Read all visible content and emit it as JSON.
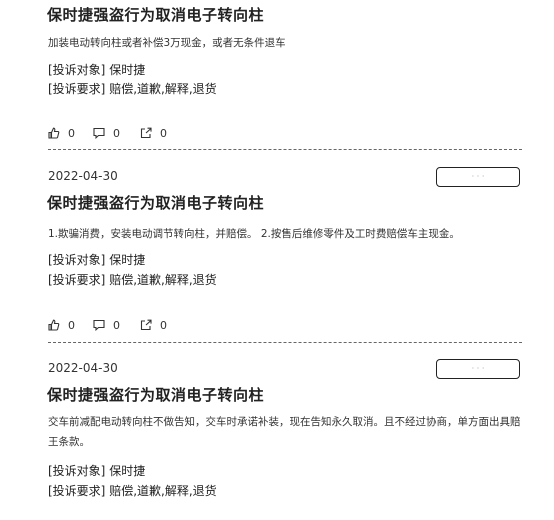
{
  "complaints": [
    {
      "title": "保时捷强盗行为取消电子转向柱",
      "description": "加装电动转向柱或者补偿3万现金，或者无条件退车",
      "target_label": "[投诉对象]",
      "target_value": "保时捷",
      "demand_label": "[投诉要求]",
      "demand_value": "赔偿,道歉,解释,退货",
      "likes": "0",
      "comments": "0",
      "shares": "0"
    },
    {
      "date": "2022-04-30",
      "tag": "· · ·",
      "title": "保时捷强盗行为取消电子转向柱",
      "description": "1.欺骗消费，安装电动调节转向柱，并赔偿。 2.按售后维修零件及工时费赔偿车主现金。",
      "target_label": "[投诉对象]",
      "target_value": "保时捷",
      "demand_label": "[投诉要求]",
      "demand_value": "赔偿,道歉,解释,退货",
      "likes": "0",
      "comments": "0",
      "shares": "0"
    },
    {
      "date": "2022-04-30",
      "tag": "· · ·",
      "title": "保时捷强盗行为取消电子转向柱",
      "description": "交车前减配电动转向柱不做告知，交车时承诺补装，现在告知永久取消。且不经过协商，单方面出具赔王条款。",
      "target_label": "[投诉对象]",
      "target_value": "保时捷",
      "demand_label": "[投诉要求]",
      "demand_value": "赔偿,道歉,解释,退货"
    }
  ],
  "icons": {
    "like": "thumbs-up-icon",
    "comment": "comment-icon",
    "share": "share-icon"
  }
}
